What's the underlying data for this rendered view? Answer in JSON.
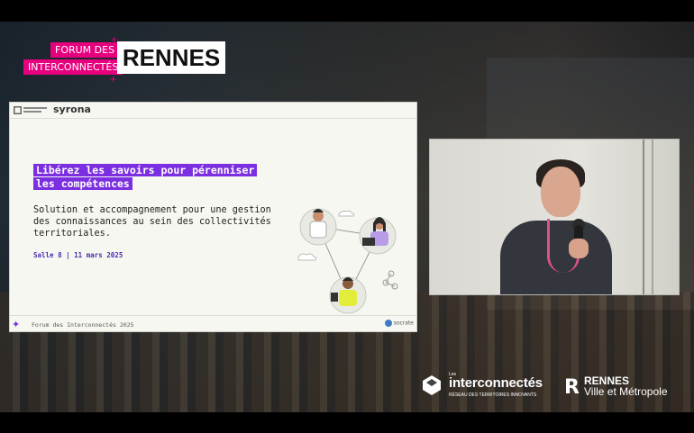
{
  "forum_logo": {
    "line1": "FORUM DES",
    "line2": "INTERCONNECTÉS",
    "city": "RENNES"
  },
  "slide": {
    "header_logo_left": "Ville de Marseille",
    "header_logo_right": "syrona",
    "title_line1": "Libérez les savoirs pour pérenniser",
    "title_line2": "les compétences",
    "subtitle": "Solution et accompagnement pour une gestion des connaissances au sein des collectivités territoriales.",
    "room": "Salle 8 | 11 mars 2025",
    "footer_text": "Forum des Interconnectés 2025",
    "footer_logo_right": "socrate",
    "accent_color": "#7b2fe0"
  },
  "bottom_logos": {
    "interconnectes_les": "Les",
    "interconnectes_name": "interconnectés",
    "interconnectes_tagline": "RÉSEAU DES TERRITOIRES INNOVANTS",
    "rennes_name": "RENNES",
    "rennes_sub": "Ville et Métropole"
  },
  "colors": {
    "brand_pink": "#e6007e",
    "slide_purple": "#7b2fe0"
  }
}
